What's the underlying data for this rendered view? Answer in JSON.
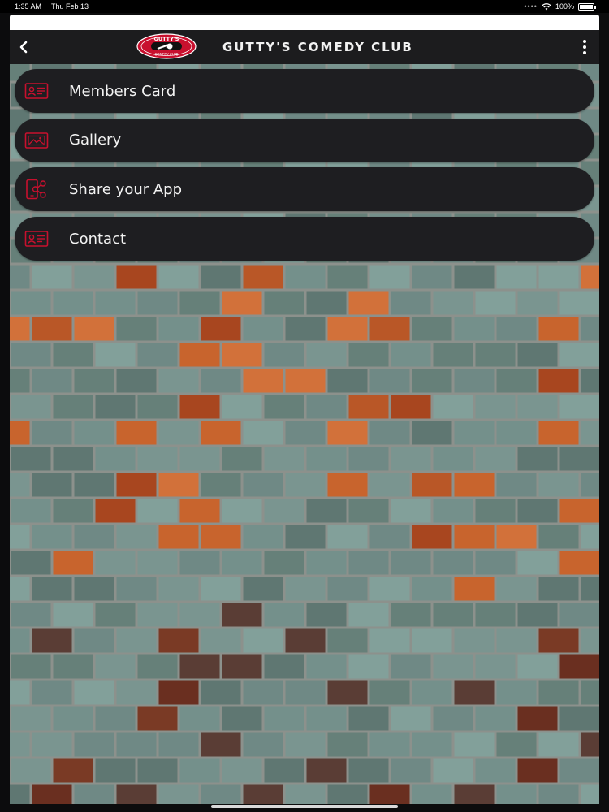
{
  "status": {
    "time": "1:35 AM",
    "date": "Thu Feb 13",
    "battery": "100%"
  },
  "header": {
    "title": "GUTTY'S COMEDY CLUB",
    "logo_text_top": "GUTTY'S",
    "logo_text_bottom": "COMEDY CLUB"
  },
  "menu": {
    "items": [
      {
        "label": "Members Card",
        "icon": "id-card-icon"
      },
      {
        "label": "Gallery",
        "icon": "gallery-icon"
      },
      {
        "label": "Share your App",
        "icon": "share-app-icon"
      },
      {
        "label": "Contact",
        "icon": "contact-card-icon"
      }
    ]
  },
  "colors": {
    "accent": "#c8102e",
    "menu_bg": "#1e1e21",
    "nav_bg": "#1c1c1e"
  }
}
